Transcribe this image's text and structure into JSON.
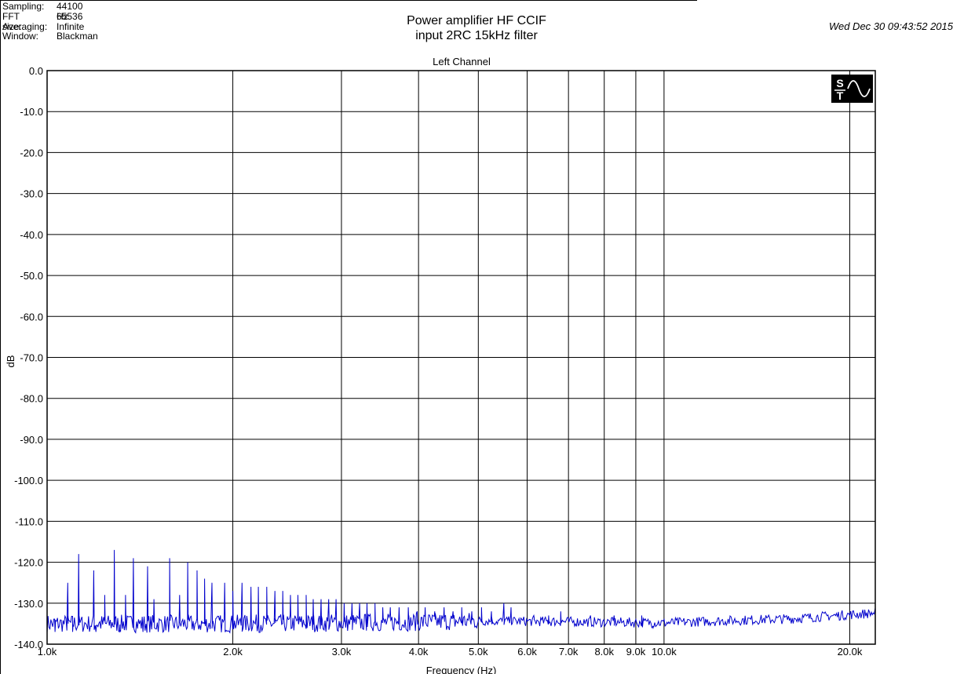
{
  "header": {
    "sampling_label": "Sampling:",
    "sampling_value": "44100 Hz",
    "fft_label": "FFT size:",
    "fft_value": "65536",
    "averaging_label": "Averaging:",
    "averaging_value": "Infinite",
    "window_label": "Window:",
    "window_value": "Blackman",
    "title_line1": "Power amplifier HF CCIF",
    "title_line2": "input 2RC 15kHz filter",
    "datetime": "Wed Dec 30 09:43:52 2015"
  },
  "chart_data": {
    "type": "line",
    "title": "Left Channel",
    "xlabel": "Frequency (Hz)",
    "ylabel": "dB",
    "xscale": "log",
    "xlim": [
      1000,
      22000
    ],
    "ylim": [
      -140,
      0
    ],
    "grid": true,
    "line_color": "#0000cc",
    "x_ticks": [
      {
        "value": 1000,
        "label": "1.0k"
      },
      {
        "value": 2000,
        "label": "2.0k"
      },
      {
        "value": 3000,
        "label": "3.0k"
      },
      {
        "value": 4000,
        "label": "4.0k"
      },
      {
        "value": 5000,
        "label": "5.0k"
      },
      {
        "value": 6000,
        "label": "6.0k"
      },
      {
        "value": 7000,
        "label": "7.0k"
      },
      {
        "value": 8000,
        "label": "8.0k"
      },
      {
        "value": 9000,
        "label": "9.0k"
      },
      {
        "value": 10000,
        "label": "10.0k"
      },
      {
        "value": 20000,
        "label": "20.0k"
      }
    ],
    "y_ticks": [
      {
        "value": 0,
        "label": "0.0"
      },
      {
        "value": -10,
        "label": "-10.0"
      },
      {
        "value": -20,
        "label": "-20.0"
      },
      {
        "value": -30,
        "label": "-30.0"
      },
      {
        "value": -40,
        "label": "-40.0"
      },
      {
        "value": -50,
        "label": "-50.0"
      },
      {
        "value": -60,
        "label": "-60.0"
      },
      {
        "value": -70,
        "label": "-70.0"
      },
      {
        "value": -80,
        "label": "-80.0"
      },
      {
        "value": -90,
        "label": "-90.0"
      },
      {
        "value": -100,
        "label": "-100.0"
      },
      {
        "value": -110,
        "label": "-110.0"
      },
      {
        "value": -120,
        "label": "-120.0"
      },
      {
        "value": -130,
        "label": "-130.0"
      },
      {
        "value": -140,
        "label": "-140.0"
      }
    ],
    "noise_floor": [
      [
        1000,
        -135
      ],
      [
        2000,
        -135
      ],
      [
        3000,
        -134.8
      ],
      [
        4000,
        -134.6
      ],
      [
        5000,
        -134.3
      ],
      [
        7000,
        -134.5
      ],
      [
        10000,
        -134.8
      ],
      [
        13000,
        -134.2
      ],
      [
        16000,
        -133.8
      ],
      [
        20000,
        -132.8
      ],
      [
        22000,
        -132.4
      ]
    ],
    "peaks": [
      {
        "x": 1080,
        "y": -125
      },
      {
        "x": 1125,
        "y": -118
      },
      {
        "x": 1190,
        "y": -122
      },
      {
        "x": 1240,
        "y": -128
      },
      {
        "x": 1285,
        "y": -117
      },
      {
        "x": 1340,
        "y": -128
      },
      {
        "x": 1380,
        "y": -119
      },
      {
        "x": 1455,
        "y": -121
      },
      {
        "x": 1490,
        "y": -129
      },
      {
        "x": 1580,
        "y": -119
      },
      {
        "x": 1640,
        "y": -128
      },
      {
        "x": 1690,
        "y": -120
      },
      {
        "x": 1750,
        "y": -122
      },
      {
        "x": 1800,
        "y": -124
      },
      {
        "x": 1850,
        "y": -125
      },
      {
        "x": 1940,
        "y": -125
      },
      {
        "x": 2000,
        "y": -127
      },
      {
        "x": 2070,
        "y": -125
      },
      {
        "x": 2140,
        "y": -126
      },
      {
        "x": 2200,
        "y": -126
      },
      {
        "x": 2270,
        "y": -126
      },
      {
        "x": 2340,
        "y": -127
      },
      {
        "x": 2410,
        "y": -127
      },
      {
        "x": 2480,
        "y": -128
      },
      {
        "x": 2550,
        "y": -128
      },
      {
        "x": 2630,
        "y": -128
      },
      {
        "x": 2700,
        "y": -129
      },
      {
        "x": 2780,
        "y": -129
      },
      {
        "x": 2860,
        "y": -129
      },
      {
        "x": 2940,
        "y": -129
      },
      {
        "x": 3030,
        "y": -130
      },
      {
        "x": 3120,
        "y": -130
      },
      {
        "x": 3210,
        "y": -130
      },
      {
        "x": 3300,
        "y": -130
      },
      {
        "x": 3400,
        "y": -130
      },
      {
        "x": 3500,
        "y": -131
      },
      {
        "x": 3600,
        "y": -131
      },
      {
        "x": 3720,
        "y": -131
      },
      {
        "x": 3850,
        "y": -131
      },
      {
        "x": 3980,
        "y": -132
      },
      {
        "x": 4100,
        "y": -131
      },
      {
        "x": 4250,
        "y": -132
      },
      {
        "x": 4400,
        "y": -131
      },
      {
        "x": 4550,
        "y": -132
      },
      {
        "x": 4700,
        "y": -131
      },
      {
        "x": 4880,
        "y": -132
      },
      {
        "x": 5060,
        "y": -131
      },
      {
        "x": 5250,
        "y": -132
      },
      {
        "x": 5500,
        "y": -130
      },
      {
        "x": 5650,
        "y": -131
      },
      {
        "x": 6150,
        "y": -133
      },
      {
        "x": 6500,
        "y": -133
      },
      {
        "x": 6800,
        "y": -132
      },
      {
        "x": 7600,
        "y": -133
      },
      {
        "x": 8300,
        "y": -133
      },
      {
        "x": 9200,
        "y": -133
      }
    ],
    "dips": [
      {
        "x": 1030,
        "y": -137
      },
      {
        "x": 1100,
        "y": -137
      },
      {
        "x": 1200,
        "y": -137
      },
      {
        "x": 1310,
        "y": -137
      },
      {
        "x": 1430,
        "y": -137
      },
      {
        "x": 9600,
        "y": -136
      }
    ]
  }
}
